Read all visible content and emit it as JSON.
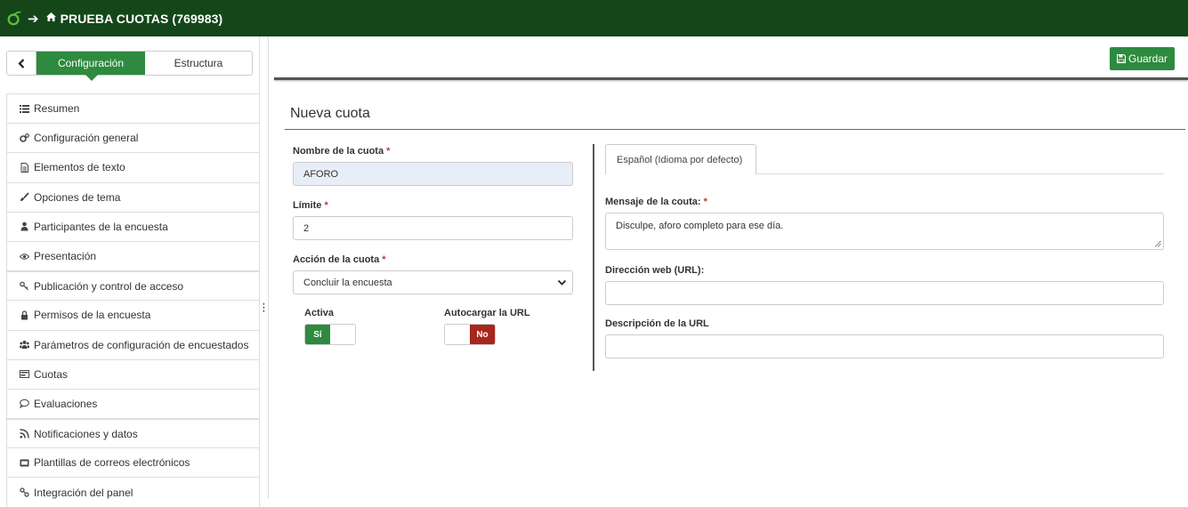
{
  "header": {
    "title": "PRUEBA CUOTAS (769983)"
  },
  "sidebar": {
    "tabs": {
      "config": "Configuración",
      "structure": "Estructura"
    },
    "items": [
      {
        "label": "Resumen",
        "icon": "list-icon"
      },
      {
        "label": "Configuración general",
        "icon": "cogs-icon"
      },
      {
        "label": "Elementos de texto",
        "icon": "file-text-icon"
      },
      {
        "label": "Opciones de tema",
        "icon": "paintbrush-icon"
      },
      {
        "label": "Participantes de la encuesta",
        "icon": "user-icon"
      },
      {
        "label": "Presentación",
        "icon": "eye-icon"
      },
      {
        "label": "Publicación y control de acceso",
        "icon": "key-icon"
      },
      {
        "label": "Permisos de la encuesta",
        "icon": "lock-icon"
      },
      {
        "label": "Parámetros de configuración de encuestados",
        "icon": "users-icon"
      },
      {
        "label": "Cuotas",
        "icon": "quota-icon"
      },
      {
        "label": "Evaluaciones",
        "icon": "comment-icon"
      },
      {
        "label": "Notificaciones y datos",
        "icon": "rss-icon"
      },
      {
        "label": "Plantillas de correos electrónicos",
        "icon": "email-template-icon"
      },
      {
        "label": "Integración del panel",
        "icon": "link-icon"
      }
    ]
  },
  "toolbar": {
    "save_label": "Guardar"
  },
  "form": {
    "title": "Nueva cuota",
    "name_label": "Nombre de la cuota",
    "name_value": "AFORO",
    "limit_label": "Límite",
    "limit_value": "2",
    "action_label": "Acción de la cuota",
    "action_value": "Concluir la encuesta",
    "active_label": "Activa",
    "active_state": "Sí",
    "autoload_label": "Autocargar la URL",
    "autoload_state": "No",
    "required_mark": "*"
  },
  "language": {
    "tab_label": "Español (Idioma por defecto)",
    "message_label": "Mensaje de la couta:",
    "message_value": "Disculpe, aforo completo para ese día.",
    "url_label": "Dirección web (URL):",
    "url_value": "",
    "url_desc_label": "Descripción de la URL",
    "url_desc_value": ""
  },
  "colors": {
    "topbar": "#14461a",
    "accent": "#2d8a3e",
    "danger": "#a8261c"
  }
}
